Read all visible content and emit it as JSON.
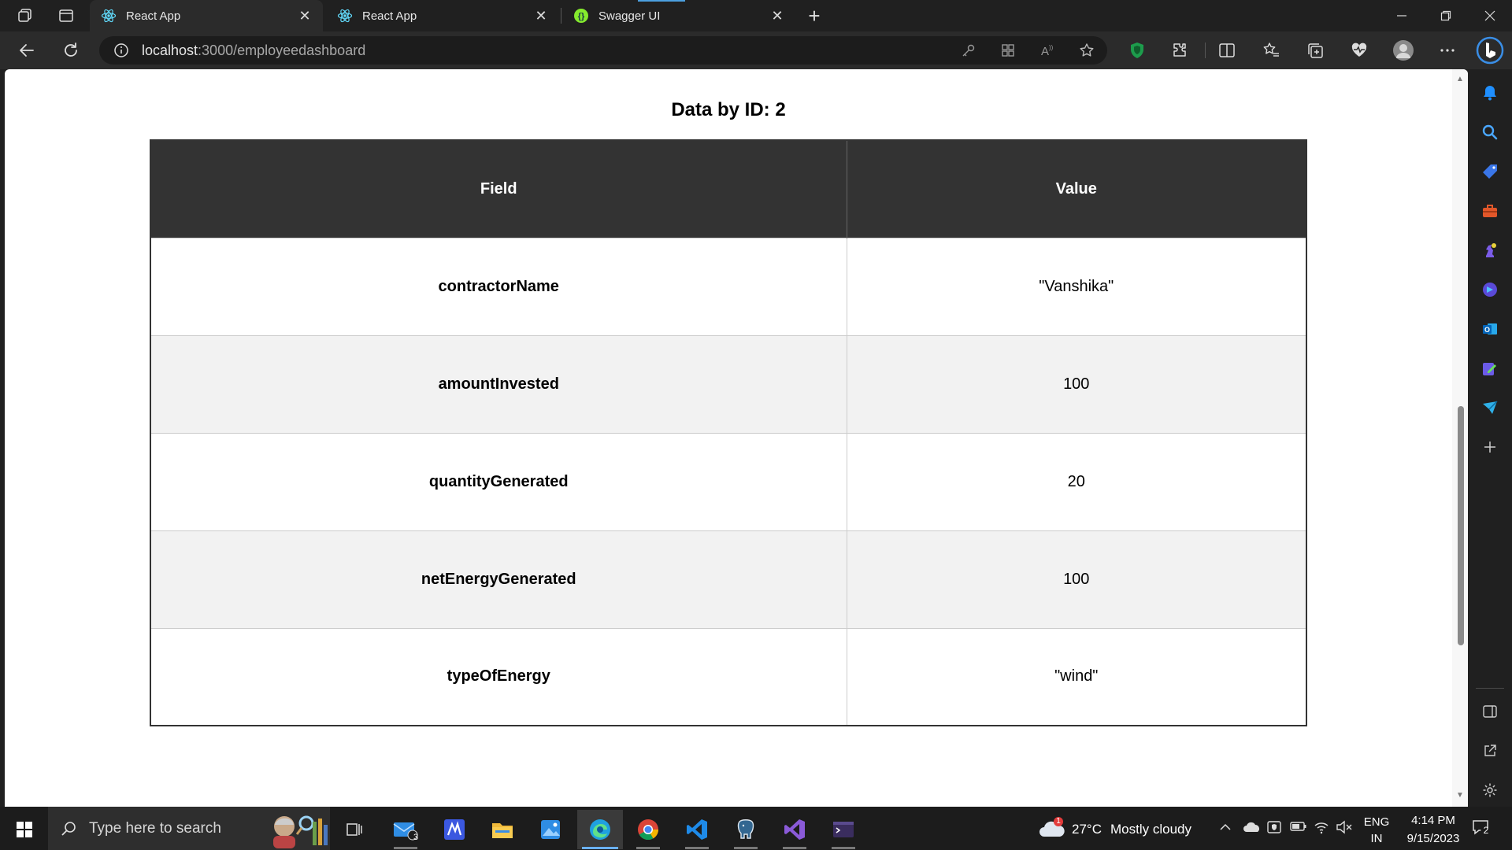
{
  "tabs": [
    {
      "title": "React App",
      "active": true,
      "favicon": "react-icon"
    },
    {
      "title": "React App",
      "active": false,
      "favicon": "react-icon"
    },
    {
      "title": "Swagger UI",
      "active": false,
      "favicon": "swagger-icon"
    }
  ],
  "address_bar": {
    "host": "localhost",
    "path": ":3000/employeedashboard"
  },
  "page": {
    "heading": "Data by ID: 2",
    "table": {
      "headers": [
        "Field",
        "Value"
      ],
      "rows": [
        {
          "field": "contractorName",
          "value": "\"Vanshika\""
        },
        {
          "field": "amountInvested",
          "value": "100"
        },
        {
          "field": "quantityGenerated",
          "value": "20"
        },
        {
          "field": "netEnergyGenerated",
          "value": "100"
        },
        {
          "field": "typeOfEnergy",
          "value": "\"wind\""
        }
      ]
    }
  },
  "taskbar": {
    "search_placeholder": "Type here to search",
    "mail_badge": "3",
    "weather": {
      "temp": "27°C",
      "condition": "Mostly cloudy",
      "alert_badge": "1"
    },
    "language": {
      "lang": "ENG",
      "region": "IN"
    },
    "clock": {
      "time": "4:14 PM",
      "date": "9/15/2023"
    },
    "notifications_count": "2"
  },
  "colors": {
    "header_bg": "#333333",
    "alt_row": "#f2f2f2",
    "accent": "#0078d4"
  }
}
